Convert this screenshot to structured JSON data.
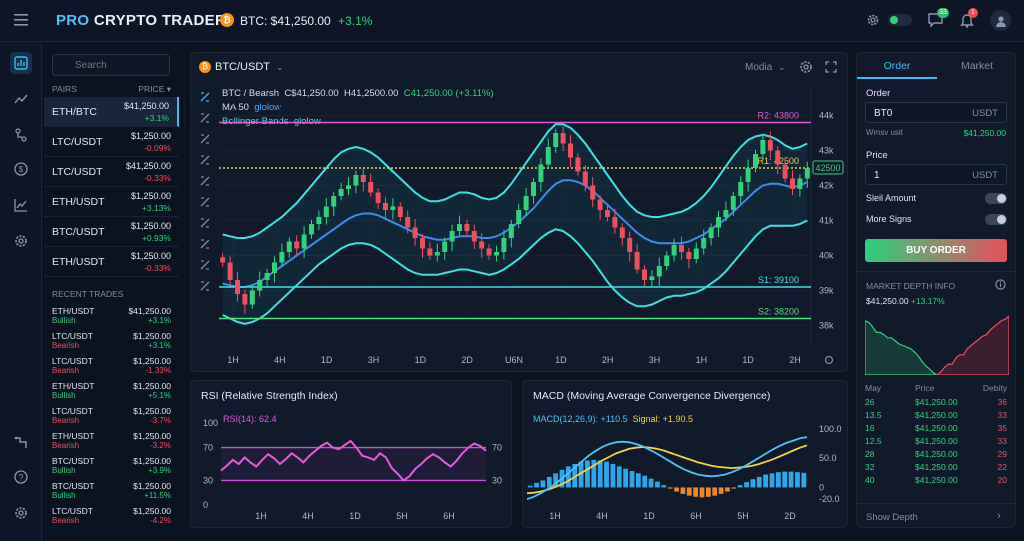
{
  "topbar": {
    "brand_a": "PRO",
    "brand_b": "CRYPTO TRADER",
    "coin_symbol": "₿",
    "ticker_label": "BTC: $41,250.00",
    "ticker_change": "+3.1%",
    "chat_badge": "33",
    "notif_badge": "1"
  },
  "sidebar": {
    "search_placeholder": "Search",
    "pairs_header": "PAIRS",
    "price_header": "PRICE ▾",
    "pairs": [
      {
        "name": "ETH/BTC",
        "price": "$41,250.00",
        "change": "+3.1%",
        "dir": "up"
      },
      {
        "name": "LTC/USDT",
        "price": "$1,250.00",
        "change": "-0.09%",
        "dir": "down"
      },
      {
        "name": "LTC/USDT",
        "price": "$41,250.00",
        "change": "-0.33%",
        "dir": "down"
      },
      {
        "name": "ETH/USDT",
        "price": "$1,250.00",
        "change": "+3.13%",
        "dir": "up"
      },
      {
        "name": "BTC/USDT",
        "price": "$1,250.00",
        "change": "+0.93%",
        "dir": "up"
      },
      {
        "name": "ETH/USDT",
        "price": "$1,250.00",
        "change": "-0.33%",
        "dir": "down"
      }
    ],
    "recent_header": "RECENT TRADES",
    "trades": [
      {
        "pair": "ETH/USDT",
        "side": "Bullish",
        "price": "$41,250.00",
        "change": "+3.1%",
        "dir": "up"
      },
      {
        "pair": "LTC/USDT",
        "side": "Bearish",
        "price": "$1,250.00",
        "change": "+3.1%",
        "dir": "up"
      },
      {
        "pair": "LTC/USDT",
        "side": "Bearish",
        "price": "$1,250.00",
        "change": "-1.33%",
        "dir": "down"
      },
      {
        "pair": "ETH/USDT",
        "side": "Bullish",
        "price": "$1,250.00",
        "change": "+5.1%",
        "dir": "up"
      },
      {
        "pair": "LTC/USDT",
        "side": "Bearish",
        "price": "$1,250.00",
        "change": "-3.7%",
        "dir": "down"
      },
      {
        "pair": "ETH/USDT",
        "side": "Bearish",
        "price": "$1,250.00",
        "change": "-3.2%",
        "dir": "down"
      },
      {
        "pair": "BTC/USDT",
        "side": "Bullish",
        "price": "$1,250.00",
        "change": "+3.9%",
        "dir": "up"
      },
      {
        "pair": "BTC/USDT",
        "side": "Bullish",
        "price": "$1,250.00",
        "change": "+11.5%",
        "dir": "up"
      },
      {
        "pair": "LTC/USDT",
        "side": "Bearish",
        "price": "$1,250.00",
        "change": "-4.2%",
        "dir": "down"
      }
    ]
  },
  "chart_header": {
    "pair": "BTC/USDT",
    "mode": "Modia",
    "info_pair": "BTC / Bearsh",
    "info_c": "C$41,250.00",
    "info_h": "H41,2500.00",
    "info_c2": "C41,250.00 (+3.11%)",
    "ma_label": "MA 50",
    "ma_glow": "glolow",
    "bb_label": "Bollinger Bands",
    "bb_glow": "glolow"
  },
  "chart_data": [
    {
      "type": "candlestick",
      "title": "BTC/USDT",
      "y_ticks": [
        "44k",
        "43k",
        "42k",
        "41k",
        "40k",
        "39k",
        "38k"
      ],
      "y_tick_values": [
        44000,
        43000,
        42000,
        41000,
        40000,
        39000,
        38000
      ],
      "ylim": [
        37500,
        44500
      ],
      "x_ticks": [
        "1H",
        "4H",
        "1D",
        "3H",
        "1D",
        "2D",
        "U6N",
        "1D",
        "2H",
        "3H",
        "1H",
        "1D",
        "2H"
      ],
      "current_price_label": "42500",
      "levels": [
        {
          "label": "R2: 43800",
          "value": 43800,
          "color": "#e05ad6"
        },
        {
          "label": "R1: 42500",
          "value": 42500,
          "color": "#e8d44a"
        },
        {
          "label": "S1: 39100",
          "value": 39100,
          "color": "#3fe0e0"
        },
        {
          "label": "S2: 38200",
          "value": 38200,
          "color": "#4de07f"
        }
      ],
      "closes": [
        39800,
        39300,
        38900,
        38600,
        39000,
        39300,
        39500,
        39800,
        40100,
        40400,
        40200,
        40600,
        40900,
        41100,
        41400,
        41700,
        41900,
        42000,
        42300,
        42100,
        41800,
        41500,
        41300,
        41400,
        41100,
        40800,
        40500,
        40200,
        40000,
        40100,
        40400,
        40700,
        40900,
        40700,
        40400,
        40200,
        40000,
        40100,
        40500,
        40900,
        41300,
        41700,
        42100,
        42600,
        43100,
        43500,
        43200,
        42800,
        42400,
        42000,
        41600,
        41300,
        41100,
        40800,
        40500,
        40100,
        39600,
        39300,
        39400,
        39700,
        40000,
        40300,
        40100,
        39900,
        40200,
        40500,
        40800,
        41100,
        41300,
        41700,
        42100,
        42500,
        42900,
        43300,
        43000,
        42600,
        42200,
        41900,
        42200,
        42500
      ],
      "ma50": [
        39200,
        39150,
        39100,
        39100,
        39150,
        39250,
        39400,
        39550,
        39700,
        39850,
        40000,
        40150,
        40300,
        40450,
        40600,
        40750,
        40900,
        41050,
        41150,
        41200,
        41200,
        41150,
        41050,
        40950,
        40850,
        40750,
        40650,
        40550,
        40500,
        40450,
        40450,
        40500,
        40550,
        40550,
        40550,
        40500,
        40500,
        40550,
        40650,
        40800,
        40950,
        41150,
        41350,
        41600,
        41850,
        42050,
        42150,
        42150,
        42100,
        42000,
        41850,
        41650,
        41450,
        41250,
        41050,
        40850,
        40650,
        40500,
        40400,
        40350,
        40350,
        40350,
        40350,
        40400,
        40500,
        40600,
        40750,
        40900,
        41050,
        41250,
        41450,
        41650,
        41850,
        42000,
        42050,
        42050,
        42000,
        41950,
        42000,
        42100
      ],
      "bb_upper": [
        40600,
        40550,
        40500,
        40500,
        40550,
        40650,
        40800,
        40950,
        41100,
        41300,
        41500,
        41750,
        42000,
        42250,
        42500,
        42750,
        42950,
        43050,
        43100,
        43050,
        42950,
        42800,
        42600,
        42400,
        42200,
        42000,
        41800,
        41650,
        41550,
        41550,
        41600,
        41700,
        41800,
        41800,
        41750,
        41650,
        41600,
        41650,
        41800,
        42050,
        42350,
        42650,
        42950,
        43250,
        43550,
        43750,
        43750,
        43650,
        43450,
        43200,
        42900,
        42600,
        42300,
        42000,
        41700,
        41450,
        41250,
        41150,
        41100,
        41100,
        41150,
        41200,
        41250,
        41350,
        41500,
        41700,
        41950,
        42250,
        42550,
        42850,
        43100,
        43300,
        43400,
        43450,
        43400,
        43300,
        43150,
        43050,
        43100,
        43200
      ],
      "bb_lower": [
        38300,
        38200,
        38100,
        38050,
        38100,
        38200,
        38350,
        38550,
        38750,
        38950,
        39150,
        39350,
        39550,
        39750,
        39900,
        40050,
        40200,
        40300,
        40350,
        40350,
        40300,
        40200,
        40050,
        39900,
        39750,
        39600,
        39500,
        39450,
        39450,
        39450,
        39500,
        39550,
        39600,
        39600,
        39550,
        39500,
        39450,
        39500,
        39600,
        39750,
        39900,
        40100,
        40300,
        40500,
        40650,
        40750,
        40700,
        40550,
        40350,
        40100,
        39850,
        39550,
        39250,
        39000,
        38800,
        38650,
        38550,
        38550,
        38600,
        38700,
        38800,
        38850,
        38850,
        38900,
        38950,
        39050,
        39200,
        39350,
        39550,
        39800,
        40050,
        40300,
        40550,
        40750,
        40850,
        40850,
        40850,
        40850,
        40900,
        41000
      ]
    },
    {
      "type": "line",
      "title": "RSI (Relative Strength Index)",
      "legend": "RSI(14): 62.4",
      "y_ticks": [
        100,
        70,
        30,
        0
      ],
      "ylim": [
        0,
        100
      ],
      "bands": [
        70,
        30
      ],
      "x_ticks": [
        "1H",
        "4H",
        "1D",
        "5H",
        "6H"
      ],
      "values": [
        42,
        48,
        55,
        50,
        58,
        52,
        47,
        55,
        62,
        57,
        50,
        56,
        63,
        58,
        52,
        60,
        66,
        72,
        76,
        70,
        68,
        73,
        78,
        70,
        60,
        58,
        55,
        63,
        58,
        45,
        38,
        30,
        35,
        44,
        50,
        57,
        62,
        58,
        52,
        47,
        54,
        63,
        70,
        75,
        72,
        66
      ]
    },
    {
      "type": "bar+line",
      "title": "MACD (Moving Average Convergence Divergence)",
      "legend_macd": "MACD(12,26,9): +110.5",
      "legend_signal": "Signal: +1.90.5",
      "y_ticks": [
        100.0,
        50.0,
        0,
        -20.0
      ],
      "ylim": [
        -30,
        110
      ],
      "x_ticks": [
        "1H",
        "4H",
        "1D",
        "6H",
        "5H",
        "2D"
      ],
      "histogram": [
        3,
        8,
        12,
        18,
        24,
        30,
        36,
        40,
        44,
        46,
        47,
        46,
        44,
        40,
        36,
        32,
        28,
        24,
        20,
        15,
        10,
        4,
        -2,
        -7,
        -11,
        -14,
        -16,
        -17,
        -16,
        -14,
        -11,
        -7,
        -2,
        4,
        9,
        14,
        18,
        22,
        24,
        26,
        27,
        27,
        26,
        25
      ],
      "macd": [
        -20,
        -16,
        -10,
        -3,
        5,
        14,
        24,
        34,
        44,
        54,
        62,
        69,
        74,
        77,
        78,
        77,
        74,
        70,
        64,
        58,
        51,
        44,
        37,
        31,
        26,
        22,
        20,
        19,
        20,
        22,
        26,
        31,
        37,
        44,
        51,
        58,
        65,
        71,
        76,
        80,
        84,
        86
      ],
      "signal": [
        -10,
        -9,
        -7,
        -4,
        0,
        5,
        11,
        18,
        25,
        32,
        39,
        46,
        52,
        58,
        62,
        66,
        68,
        69,
        68,
        66,
        63,
        59,
        55,
        51,
        47,
        43,
        40,
        37,
        35,
        34,
        33,
        34,
        35,
        37,
        40,
        44,
        48,
        53,
        58,
        63,
        68,
        72
      ]
    },
    {
      "type": "area",
      "title": "MARKET DEPTH INFO",
      "bids": [
        70,
        68,
        62,
        55,
        55,
        52,
        48,
        48,
        44,
        40,
        38,
        36,
        34,
        30,
        25,
        18,
        12,
        8,
        3,
        0
      ],
      "asks": [
        0,
        4,
        10,
        14,
        14,
        22,
        26,
        26,
        34,
        38,
        42,
        46,
        50,
        52,
        58,
        62,
        66,
        70,
        72,
        76
      ]
    }
  ],
  "order_panel": {
    "tab_order": "Order",
    "tab_market": "Market",
    "order_label": "Order",
    "order_value": "BT0",
    "order_unit": "USDT",
    "wmsv_label": "Wmsv usit",
    "wmsv_value": "$41,250.00",
    "price_label": "Price",
    "price_value": "1",
    "price_unit": "USDT",
    "sleil_label": "Sleil Amount",
    "more_label": "More Signs",
    "buy_label": "BUY ORDER",
    "depth_title": "MARKET DEPTH INFO",
    "depth_price": "$41,250.00",
    "depth_change": "+13.17%",
    "ob_headers": [
      "May",
      "Price",
      "Debity"
    ],
    "orderbook": [
      [
        "26",
        "$41,250.00",
        "36"
      ],
      [
        "13.5",
        "$41,250.00",
        "33"
      ],
      [
        "16",
        "$41,250.00",
        "35"
      ],
      [
        "12.5",
        "$41,250.00",
        "33"
      ],
      [
        "28",
        "$41,250.00",
        "29"
      ],
      [
        "32",
        "$41,250.00",
        "22"
      ],
      [
        "40",
        "$41,250.00",
        "20"
      ]
    ],
    "show_depth": "Show Depth"
  },
  "colors": {
    "accent": "#35c0f0",
    "up": "#34d17c",
    "down": "#ef4f5f",
    "panel": "#111a2b",
    "bg": "#0b1220"
  }
}
